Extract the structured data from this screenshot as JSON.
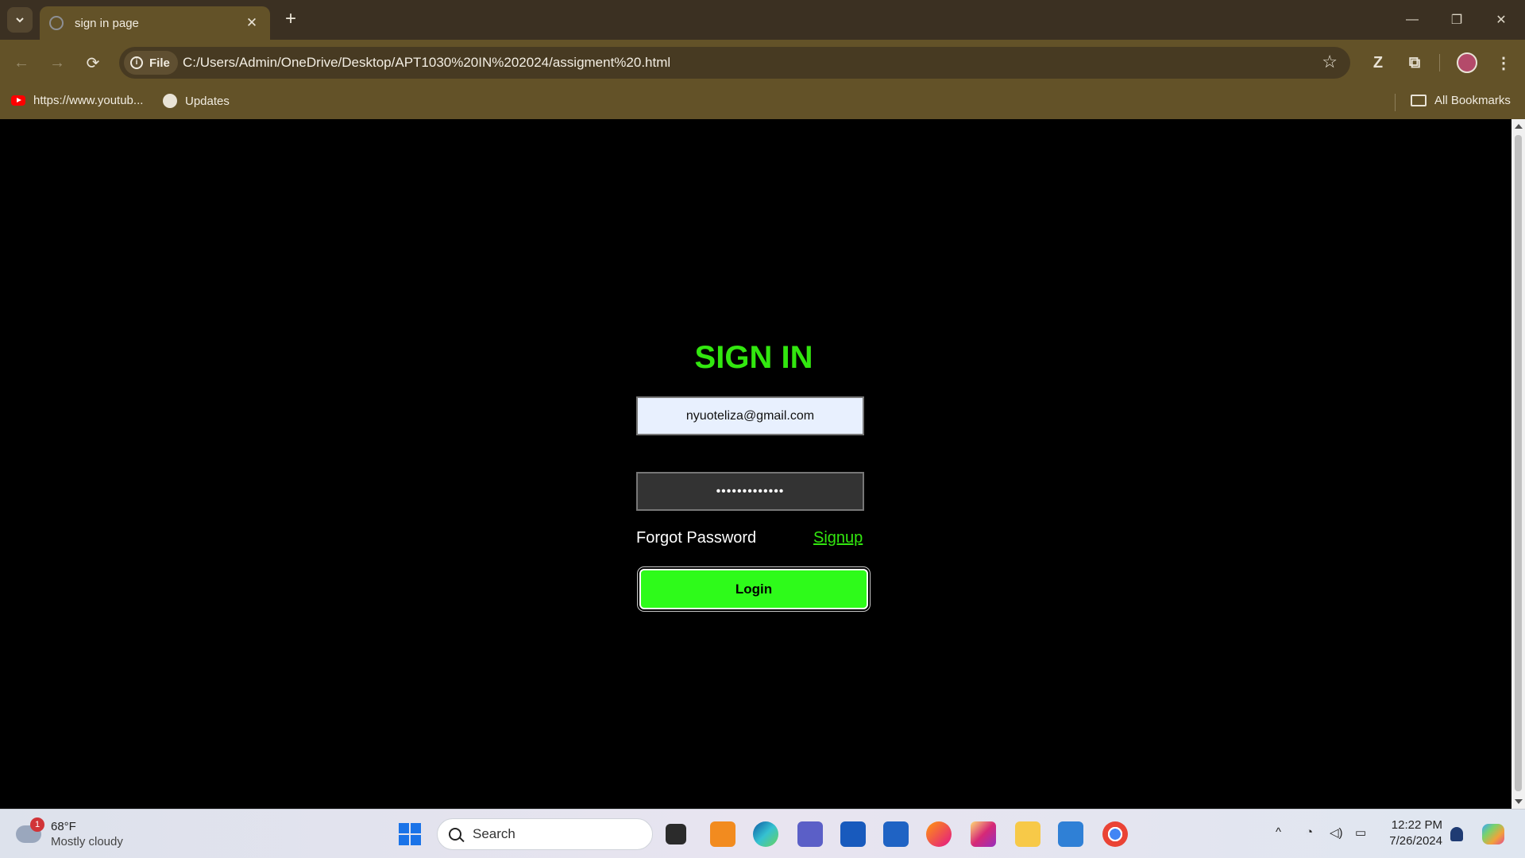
{
  "browser": {
    "tab_title": "sign in page",
    "tab_close": "✕",
    "new_tab": "+",
    "window_controls": {
      "minimize": "—",
      "restore": "❐",
      "close": "✕"
    },
    "nav": {
      "back": "←",
      "forward": "→",
      "reload": "⟳"
    },
    "site_info_label": "File",
    "url": "C:/Users/Admin/OneDrive/Desktop/APT1030%20IN%202024/assigment%20.html",
    "bookmarks": [
      {
        "label": "https://www.youtub...",
        "icon": "youtube-icon"
      },
      {
        "label": "Updates",
        "icon": "globe-icon"
      }
    ],
    "all_bookmarks": "All Bookmarks"
  },
  "page": {
    "heading": "SIGN IN",
    "email_value": "nyuoteliza@gmail.com",
    "password_value": "•••••••••••••",
    "forgot_password": "Forgot Password",
    "signup": "Signup",
    "login_button": "Login",
    "colors": {
      "accent": "#32e70f",
      "button": "#2efb1a",
      "background": "#000000"
    }
  },
  "taskbar": {
    "weather": {
      "temp": "68°F",
      "condition": "Mostly cloudy",
      "badge": "1"
    },
    "search_label": "Search",
    "apps": [
      "file-explorer-icon",
      "edge-icon",
      "teams-icon",
      "word-icon",
      "store-icon",
      "firefox-icon",
      "instagram-icon",
      "folder-icon",
      "vscode-icon",
      "chrome-icon"
    ],
    "time": "12:22 PM",
    "date": "7/26/2024"
  }
}
